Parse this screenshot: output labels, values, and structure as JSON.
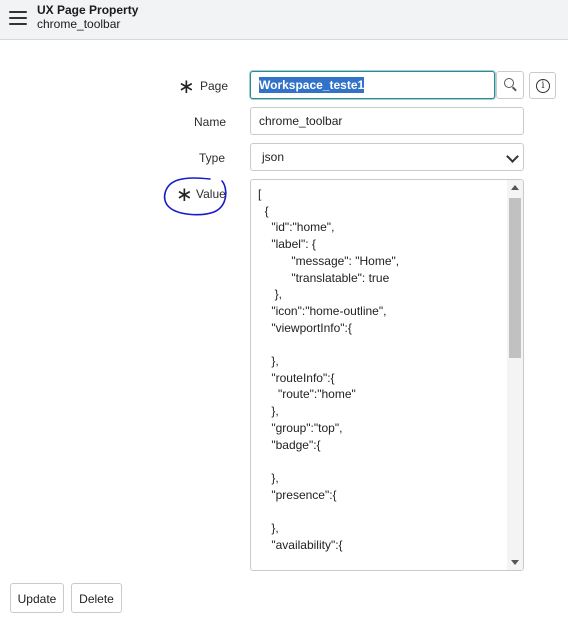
{
  "header": {
    "record_type": "UX Page Property",
    "record_name": "chrome_toolbar",
    "menu_icon": "hamburger-menu-icon"
  },
  "form": {
    "page": {
      "label": "Page",
      "required": true,
      "value": "Workspace_teste1",
      "lookup_icon": "search-icon",
      "info_icon": "info-icon"
    },
    "name": {
      "label": "Name",
      "value": "chrome_toolbar"
    },
    "type": {
      "label": "Type",
      "value": "json"
    },
    "value": {
      "label": "Value",
      "required": true,
      "content": "[\n  {\n    \"id\":\"home\",\n    \"label\": {\n          \"message\": \"Home\",\n          \"translatable\": true\n     },\n    \"icon\":\"home-outline\",\n    \"viewportInfo\":{\n\n    },\n    \"routeInfo\":{\n      \"route\":\"home\"\n    },\n    \"group\":\"top\",\n    \"badge\":{\n\n    },\n    \"presence\":{\n\n    },\n    \"availability\":{"
    }
  },
  "buttons": {
    "update": "Update",
    "delete": "Delete"
  },
  "colors": {
    "annotation_circle": "#1a1acc",
    "focus_border": "#2b8a94",
    "selection": "#3272c8"
  }
}
